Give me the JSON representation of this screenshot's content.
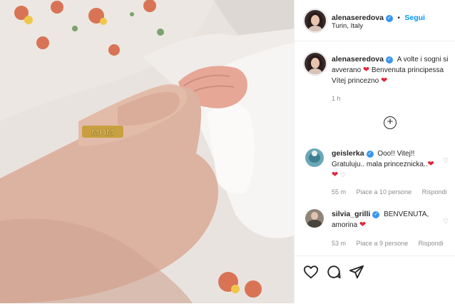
{
  "post": {
    "image_alt": "Mother's hand with MOM ring holding newborn baby's hand",
    "ring_text": "MOM"
  },
  "header": {
    "username": "alenaseredova",
    "dot": "•",
    "follow_label": "Segui",
    "location": "Turin, Italy"
  },
  "caption": {
    "username": "alenaseredova",
    "line1": "A volte i sogni si",
    "line2": "avverano",
    "line2b": "Benvenuta principessa",
    "line3": "Vítej princezno",
    "time": "1 h"
  },
  "comments": [
    {
      "username": "geislerka",
      "line1": "Ooo!! Vitej!!",
      "line2": "Gratuluju.. mala princeznicka..",
      "time": "55 m",
      "likes": "Piace a 10 persone",
      "reply": "Rispondi"
    },
    {
      "username": "silvia_grilli",
      "line1": "BENVENUTA,",
      "line2": "amorina",
      "time": "53 m",
      "likes": "Piace a 9 persone",
      "reply": "Rispondi"
    }
  ],
  "icons": {
    "verified": "✓",
    "heart": "❤",
    "small_heart": "♡",
    "plus": "+"
  },
  "colors": {
    "accent": "#0095f6",
    "verified": "#3897f0",
    "heart": "#e0263c",
    "muted": "#8e8e8e"
  }
}
